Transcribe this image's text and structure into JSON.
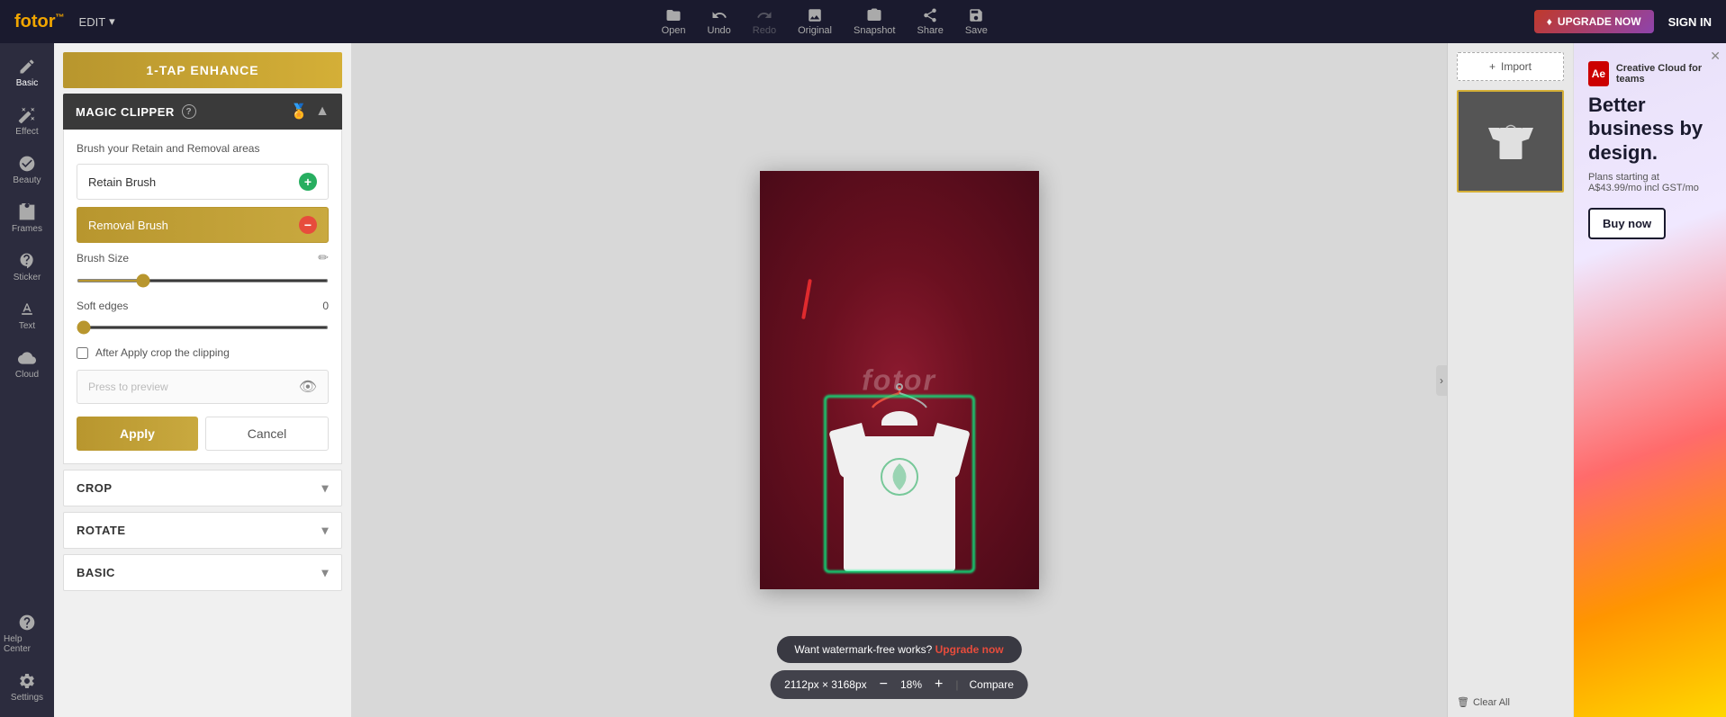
{
  "app": {
    "logo_text": "fotor",
    "logo_symbol": "™"
  },
  "topbar": {
    "edit_label": "EDIT",
    "open_label": "Open",
    "undo_label": "Undo",
    "redo_label": "Redo",
    "original_label": "Original",
    "snapshot_label": "Snapshot",
    "share_label": "Share",
    "save_label": "Save",
    "upgrade_label": "UPGRADE NOW",
    "signin_label": "SIGN IN"
  },
  "left_sidebar": {
    "items": [
      {
        "id": "basic",
        "label": "Basic",
        "active": true
      },
      {
        "id": "effect",
        "label": "Effect"
      },
      {
        "id": "beauty",
        "label": "Beauty"
      },
      {
        "id": "frames",
        "label": "Frames"
      },
      {
        "id": "sticker",
        "label": "Sticker"
      },
      {
        "id": "text",
        "label": "Text"
      },
      {
        "id": "cloud",
        "label": "Cloud"
      },
      {
        "id": "help",
        "label": "Help Center"
      },
      {
        "id": "settings",
        "label": "Settings"
      }
    ]
  },
  "panel": {
    "one_tap_label": "1-TAP ENHANCE",
    "magic_clipper_label": "MAGIC CLIPPER",
    "magic_clipper_help": "?",
    "brush_section_label": "Brush your Retain and Removal areas",
    "retain_brush_label": "Retain Brush",
    "removal_brush_label": "Removal Brush",
    "brush_size_label": "Brush Size",
    "brush_size_value": "",
    "soft_edges_label": "Soft edges",
    "soft_edges_value": "0",
    "after_apply_label": "After Apply crop the clipping",
    "press_preview_label": "Press to preview",
    "apply_label": "Apply",
    "cancel_label": "Cancel",
    "crop_label": "CROP",
    "rotate_label": "ROTATE",
    "basic_label": "BASIC"
  },
  "canvas": {
    "watermark": "fotor",
    "upgrade_text": "Want watermark-free works?",
    "upgrade_link": "Upgrade now",
    "image_size": "2112px × 3168px",
    "zoom_level": "18%",
    "compare_label": "Compare"
  },
  "right_panel": {
    "import_label": "Import",
    "clear_all_label": "Clear All"
  },
  "ad": {
    "close_symbol": "✕",
    "logo": "Ae",
    "title": "Better business by design.",
    "subtitle": "Plans starting at A$43.99/mo incl GST/mo",
    "product": "Creative Cloud for teams",
    "buy_label": "Buy now"
  }
}
